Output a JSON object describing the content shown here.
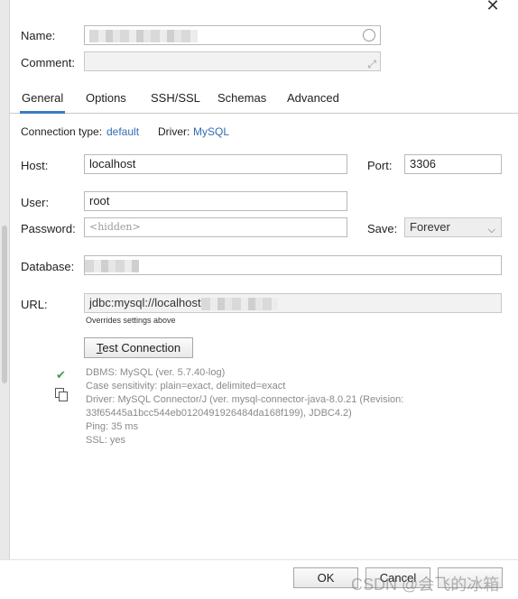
{
  "labels": {
    "name": "Name:",
    "comment": "Comment:",
    "connection_type": "Connection type:",
    "connection_type_value": "default",
    "driver": "Driver:",
    "driver_value": "MySQL",
    "host": "Host:",
    "port": "Port:",
    "user": "User:",
    "password": "Password:",
    "save": "Save:",
    "database": "Database:",
    "url": "URL:",
    "url_hint": "Overrides settings above"
  },
  "tabs": [
    {
      "label": "General",
      "active": true
    },
    {
      "label": "Options",
      "active": false
    },
    {
      "label": "SSH/SSL",
      "active": false
    },
    {
      "label": "Schemas",
      "active": false
    },
    {
      "label": "Advanced",
      "active": false
    }
  ],
  "fields": {
    "host": "localhost",
    "port": "3306",
    "user": "root",
    "password_placeholder": "<hidden>",
    "save": "Forever",
    "url_prefix": "jdbc:mysql://localhost"
  },
  "buttons": {
    "test_connection_underlined": "T",
    "test_connection_rest": "est Connection",
    "ok": "OK",
    "cancel": "Cancel",
    "close": "✕"
  },
  "connection_info": [
    "DBMS: MySQL (ver. 5.7.40-log)",
    "Case sensitivity: plain=exact, delimited=exact",
    "Driver: MySQL Connector/J (ver. mysql-connector-java-8.0.21 (Revision:",
    "33f65445a1bcc544eb0120491926484da168f199), JDBC4.2)",
    "Ping: 35 ms",
    "SSL: yes"
  ],
  "icons": {
    "check": "check-icon",
    "copy": "copy-icon",
    "expand": "expand-icon",
    "dropdown": "chevron-down-icon"
  },
  "colors": {
    "accent": "#3c7ac4",
    "link": "#2f6db5",
    "success": "#3f9a4a"
  },
  "watermark": "CSDN @会飞的冰箱"
}
